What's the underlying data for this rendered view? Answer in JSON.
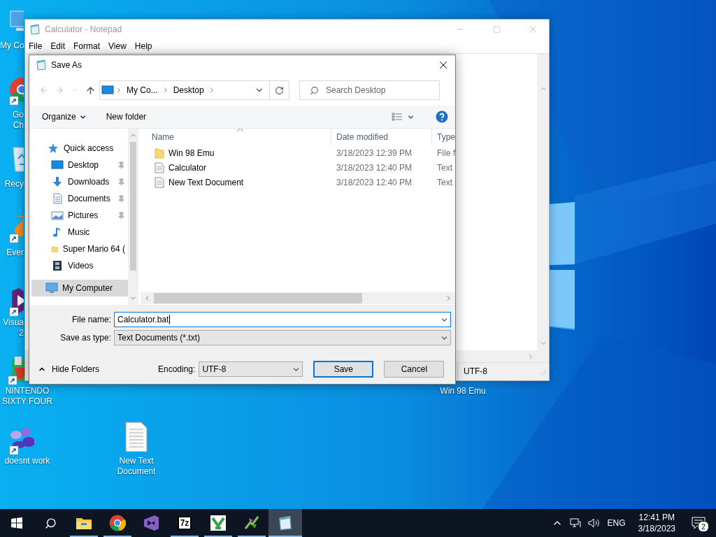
{
  "desktop_icons": [
    {
      "kind": "computer",
      "shortcut": false,
      "label": [
        "My Co"
      ]
    },
    {
      "kind": "browser",
      "shortcut": true,
      "label": [
        "Go",
        "Ch"
      ]
    },
    {
      "kind": "recycle",
      "shortcut": false,
      "label": [
        "Recy"
      ]
    },
    {
      "kind": "ever",
      "shortcut": true,
      "label": [
        "Ever"
      ]
    },
    {
      "kind": "studio",
      "shortcut": true,
      "label": [
        "Visua",
        "2"
      ]
    },
    {
      "kind": "n64",
      "shortcut": true,
      "label": [
        "NINTENDO",
        "SIXTY FOUR"
      ]
    },
    {
      "kind": "blobs",
      "shortcut": true,
      "label": [
        "doesnt work"
      ]
    },
    {
      "kind": "document",
      "shortcut": false,
      "label": [
        "New Text",
        "Document"
      ]
    },
    {
      "kind": "hidden",
      "label": [
        "Win 98 Emu"
      ]
    }
  ],
  "notepad": {
    "title": "Calculator - Notepad",
    "active": false,
    "menu": [
      "File",
      "Edit",
      "Format",
      "View",
      "Help"
    ],
    "status_bar": [
      "UTF-8"
    ]
  },
  "save_dialog": {
    "title": "Save As",
    "address": {
      "segments": [
        "My Co...",
        "Desktop"
      ]
    },
    "search": {
      "placeholder": "Search Desktop"
    },
    "toolbar": {
      "organize": "Organize",
      "new_folder": "New folder"
    },
    "nav": [
      {
        "label": "Quick access",
        "kind": "star",
        "selected": false,
        "children": [
          {
            "label": "Desktop",
            "kind": "desktop",
            "pinned": true,
            "selected": false
          },
          {
            "label": "Downloads",
            "kind": "download",
            "pinned": true,
            "selected": false
          },
          {
            "label": "Documents",
            "kind": "documents",
            "pinned": true,
            "selected": false
          },
          {
            "label": "Pictures",
            "kind": "pictures",
            "pinned": true,
            "selected": false
          },
          {
            "label": "Music",
            "kind": "music",
            "pinned": false,
            "selected": false
          },
          {
            "label": "Super Mario 64 (",
            "kind": "folder",
            "pinned": false,
            "selected": false
          },
          {
            "label": "Videos",
            "kind": "videos",
            "pinned": false,
            "selected": false
          }
        ]
      },
      {
        "label": "My Computer",
        "kind": "computer",
        "selected": true
      }
    ],
    "columns": [
      {
        "label": "Name",
        "sorted": true
      },
      {
        "label": "Date modified",
        "sorted": false
      },
      {
        "label": "Type",
        "sorted": false
      }
    ],
    "files": [
      {
        "name": "Win 98 Emu",
        "kind": "folder",
        "date": "3/18/2023 12:39 PM",
        "type": "File f",
        "selected": false
      },
      {
        "name": "Calculator",
        "kind": "document",
        "date": "3/18/2023 12:40 PM",
        "type": "Text",
        "selected": false
      },
      {
        "name": "New Text Document",
        "kind": "document",
        "date": "3/18/2023 12:40 PM",
        "type": "Text",
        "selected": false
      }
    ],
    "file_name": {
      "label": "File name:",
      "value": "Calculator.bat"
    },
    "save_as_type": {
      "label": "Save as type:",
      "value": "Text Documents (*.txt)"
    },
    "hide_folders": "Hide Folders",
    "encoding": {
      "label": "Encoding:",
      "value": "UTF-8"
    },
    "buttons": [
      {
        "label": "Save",
        "default": true
      },
      {
        "label": "Cancel",
        "default": false
      }
    ]
  },
  "taskbar": {
    "apps": [
      {
        "kind": "explorer",
        "running": true,
        "selected": false
      },
      {
        "kind": "browser",
        "running": true,
        "selected": false
      },
      {
        "kind": "studio",
        "running": false,
        "selected": false
      },
      {
        "kind": "archive",
        "label": "7z",
        "running": true,
        "selected": false
      },
      {
        "kind": "installer",
        "running": true,
        "selected": false
      },
      {
        "kind": "plant",
        "running": true,
        "selected": false
      },
      {
        "kind": "notepad",
        "running": true,
        "selected": true
      }
    ],
    "tray": {
      "language": "ENG",
      "time": "12:41 PM",
      "date": "3/18/2023",
      "notifications": "2"
    }
  }
}
